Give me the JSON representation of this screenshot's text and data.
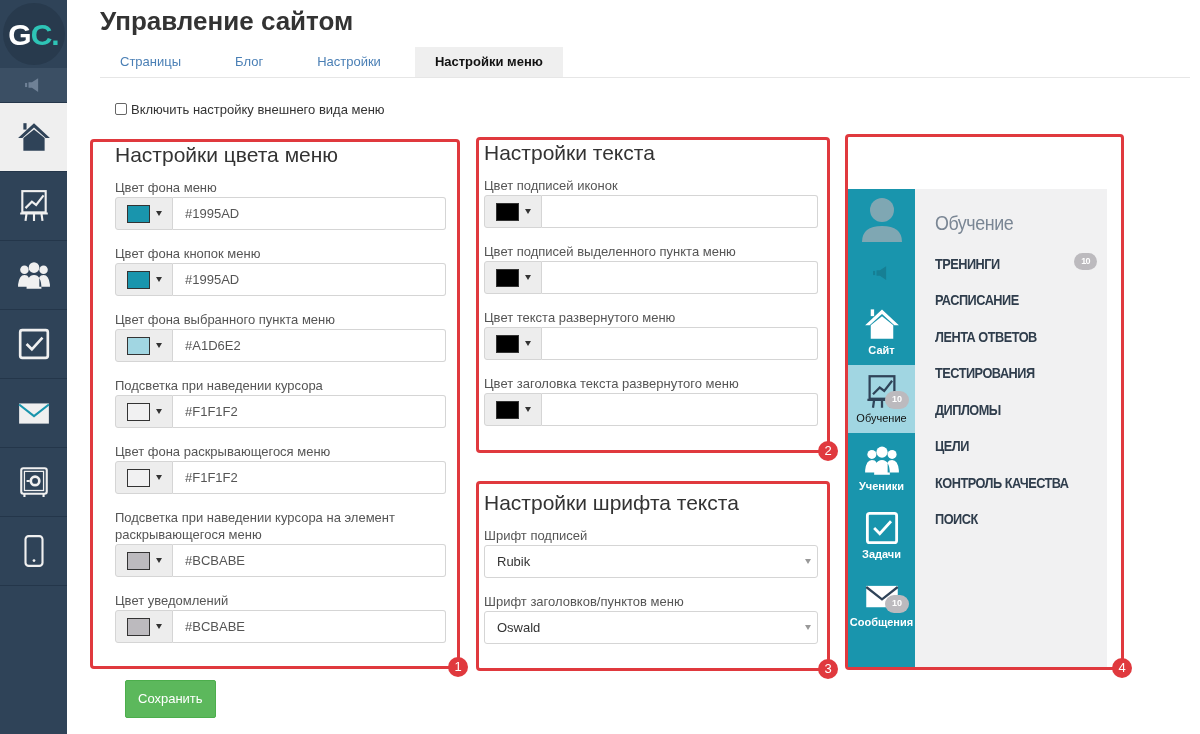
{
  "sidebar": {
    "logo": {
      "letter": "G",
      "accent": "C."
    },
    "items": [
      {
        "selected": false
      },
      {
        "selected": true
      },
      {
        "selected": false
      },
      {
        "selected": false
      },
      {
        "selected": false
      },
      {
        "selected": false
      },
      {
        "selected": false
      },
      {
        "selected": false
      }
    ]
  },
  "title": "Управление сайтом",
  "tabs": [
    {
      "label": "Страницы",
      "selected": false
    },
    {
      "label": "Блог",
      "selected": false
    },
    {
      "label": "Настройки",
      "selected": false
    },
    {
      "label": "Настройки меню",
      "selected": true
    }
  ],
  "enable_checkbox": {
    "label": "Включить настройку внешнего вида меню",
    "checked": false
  },
  "color_panel": {
    "title": "Настройки цвета меню",
    "marker": "1",
    "fields": [
      {
        "label": "Цвет фона меню",
        "value": "#1995AD",
        "color": "#1995ad"
      },
      {
        "label": "Цвет фона кнопок меню",
        "value": "#1995AD",
        "color": "#1995ad"
      },
      {
        "label": "Цвет фона выбранного пункта меню",
        "value": "#A1D6E2",
        "color": "#a1d6e2"
      },
      {
        "label": "Подсветка при наведении курсора",
        "value": "#F1F1F2",
        "color": "#f1f1f2"
      },
      {
        "label": "Цвет фона раскрывающегося меню",
        "value": "#F1F1F2",
        "color": "#f1f1f2"
      },
      {
        "label": "Подсветка при наведении курсора на элемент раскрывающегося меню",
        "value": "#BCBABE",
        "color": "#bcbabe"
      },
      {
        "label": "Цвет уведомлений",
        "value": "#BCBABE",
        "color": "#bcbabe"
      }
    ]
  },
  "text_panel": {
    "title": "Настройки текста",
    "marker": "2",
    "fields": [
      {
        "label": "Цвет подписей иконок",
        "color": "#000000"
      },
      {
        "label": "Цвет подписей выделенного пункта меню",
        "color": "#000000"
      },
      {
        "label": "Цвет текста развернутого меню",
        "color": "#000000"
      },
      {
        "label": "Цвет заголовка текста развернутого меню",
        "color": "#000000"
      }
    ]
  },
  "font_panel": {
    "title": "Настройки шрифта текста",
    "marker": "3",
    "selects": [
      {
        "label": "Шрифт подписей",
        "value": "Rubik"
      },
      {
        "label": "Шрифт заголовков/пунктов меню",
        "value": "Oswald"
      }
    ]
  },
  "preview": {
    "marker": "4",
    "rail": [
      {
        "kind": "avatar"
      },
      {
        "kind": "speaker"
      },
      {
        "kind": "nav",
        "label": "Сайт",
        "selected": false
      },
      {
        "kind": "nav",
        "label": "Обучение",
        "selected": true,
        "badge": "10"
      },
      {
        "kind": "nav",
        "label": "Ученики",
        "selected": false
      },
      {
        "kind": "nav",
        "label": "Задачи",
        "selected": false
      },
      {
        "kind": "nav",
        "label": "Сообщения",
        "selected": false,
        "badge": "10"
      }
    ],
    "menu_title": "Обучение",
    "menu_items": [
      {
        "label": "ТРЕНИНГИ",
        "badge": "10"
      },
      {
        "label": "РАСПИСАНИЕ"
      },
      {
        "label": "ЛЕНТА ОТВЕТОВ"
      },
      {
        "label": "ТЕСТИРОВАНИЯ"
      },
      {
        "label": "ДИПЛОМЫ"
      },
      {
        "label": "ЦЕЛИ"
      },
      {
        "label": "КОНТРОЛЬ КАЧЕСТВА"
      },
      {
        "label": "ПОИСК"
      }
    ]
  },
  "save_button": "Сохранить"
}
